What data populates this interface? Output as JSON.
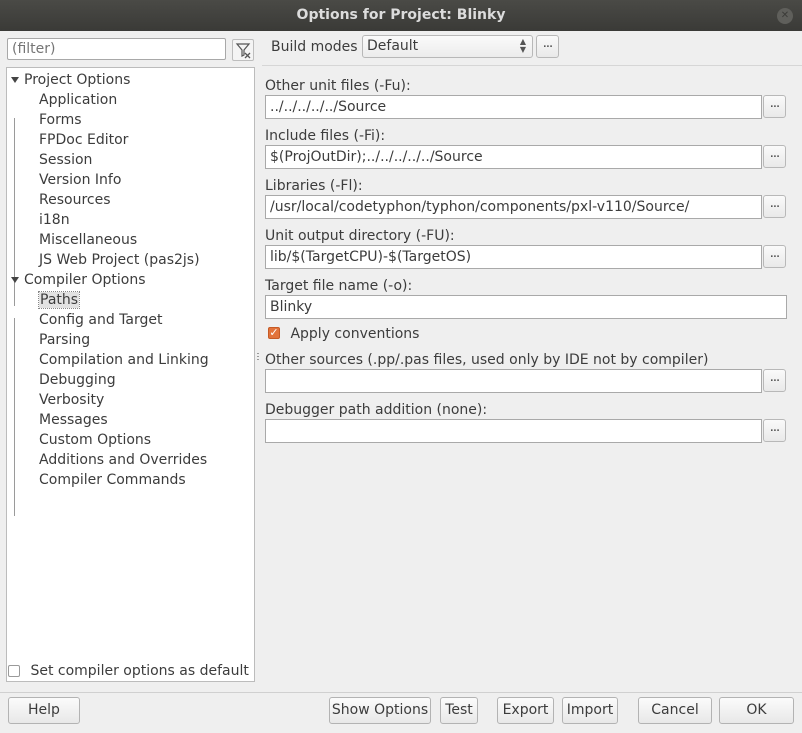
{
  "window": {
    "title": "Options for Project: Blinky"
  },
  "filter": {
    "placeholder": "(filter)"
  },
  "tree": {
    "items": [
      {
        "label": "Project Options",
        "level": 0,
        "expanded": true
      },
      {
        "label": "Application",
        "level": 1
      },
      {
        "label": "Forms",
        "level": 1
      },
      {
        "label": "FPDoc Editor",
        "level": 1
      },
      {
        "label": "Session",
        "level": 1
      },
      {
        "label": "Version Info",
        "level": 1
      },
      {
        "label": "Resources",
        "level": 1
      },
      {
        "label": "i18n",
        "level": 1
      },
      {
        "label": "Miscellaneous",
        "level": 1
      },
      {
        "label": "JS Web Project (pas2js)",
        "level": 1
      },
      {
        "label": "Compiler Options",
        "level": 0,
        "expanded": true
      },
      {
        "label": "Paths",
        "level": 1,
        "selected": true
      },
      {
        "label": "Config and Target",
        "level": 1
      },
      {
        "label": "Parsing",
        "level": 1
      },
      {
        "label": "Compilation and Linking",
        "level": 1
      },
      {
        "label": "Debugging",
        "level": 1
      },
      {
        "label": "Verbosity",
        "level": 1
      },
      {
        "label": "Messages",
        "level": 1
      },
      {
        "label": "Custom Options",
        "level": 1
      },
      {
        "label": "Additions and Overrides",
        "level": 1
      },
      {
        "label": "Compiler Commands",
        "level": 1
      }
    ]
  },
  "default_option": {
    "label": "Set compiler options as default",
    "checked": false
  },
  "build_modes": {
    "label": "Build modes",
    "value": "Default",
    "more": "..."
  },
  "paths": {
    "other_unit_files": {
      "label": "Other unit files (-Fu):",
      "value": "../../../../../Source",
      "button": "..."
    },
    "include_files": {
      "label": "Include files (-Fi):",
      "value": "$(ProjOutDir);../../../../../Source",
      "button": "..."
    },
    "libraries": {
      "label": "Libraries (-Fl):",
      "value": "/usr/local/codetyphon/typhon/components/pxl-v110/Source/",
      "button": "..."
    },
    "unit_output": {
      "label": "Unit output directory (-FU):",
      "value": "lib/$(TargetCPU)-$(TargetOS)",
      "button": "..."
    },
    "target_file": {
      "label": "Target file name (-o):",
      "value": "Blinky"
    },
    "apply_conventions": {
      "label": "Apply conventions",
      "checked": true
    },
    "other_sources": {
      "label": "Other sources (.pp/.pas files, used only by IDE not by compiler)",
      "value": "",
      "button": "..."
    },
    "debugger_path": {
      "label": "Debugger path addition (none):",
      "value": "",
      "button": "..."
    }
  },
  "buttons": {
    "help": "Help",
    "show_options": "Show Options",
    "test": "Test",
    "export": "Export",
    "import": "Import",
    "cancel": "Cancel",
    "ok": "OK"
  },
  "colors": {
    "titlebar": "#3e3e3b",
    "checkbox_accent": "#e2733b",
    "background": "#efefef"
  }
}
